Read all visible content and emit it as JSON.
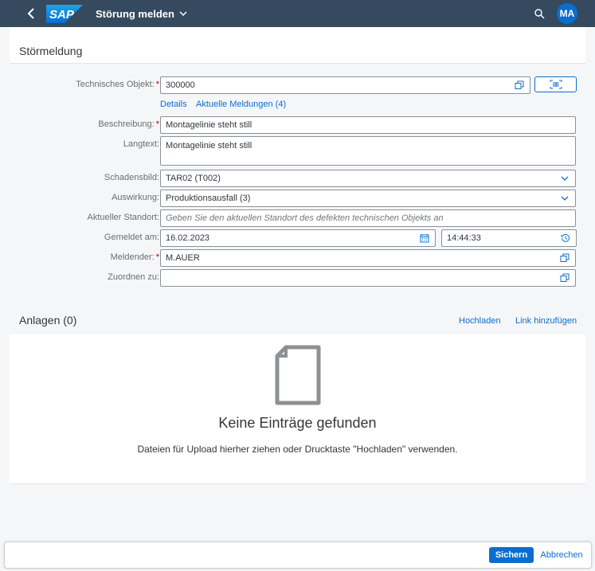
{
  "shell": {
    "app_title": "Störung melden",
    "user_initials": "MA",
    "logo_text": "SAP"
  },
  "section": {
    "title": "Störmeldung"
  },
  "form": {
    "technical_object": {
      "label": "Technisches Objekt:",
      "value": "300000"
    },
    "links": {
      "details": "Details",
      "current_reports": "Aktuelle Meldungen (4)"
    },
    "description": {
      "label": "Beschreibung:",
      "value": "Montagelinie steht still"
    },
    "long_text": {
      "label": "Langtext:",
      "value": "Montagelinie steht still"
    },
    "damage": {
      "label": "Schadensbild:",
      "value": "TAR02 (T002)"
    },
    "effect": {
      "label": "Auswirkung:",
      "value": "Produktionsausfall (3)"
    },
    "location": {
      "label": "Aktueller Standort:",
      "placeholder": "Geben Sie den aktuellen Standort des defekten technischen Objekts an"
    },
    "reported_on": {
      "label": "Gemeldet am:",
      "date": "16.02.2023",
      "time": "14:44:33"
    },
    "reporter": {
      "label": "Meldender:",
      "value": "M.AUER"
    },
    "assign_to": {
      "label": "Zuordnen zu:",
      "value": ""
    }
  },
  "attachments": {
    "title": "Anlagen (0)",
    "upload_label": "Hochladen",
    "add_link_label": "Link hinzufügen",
    "empty_title": "Keine Einträge gefunden",
    "empty_description": "Dateien für Upload hierher ziehen oder Drucktaste \"Hochladen\" verwenden."
  },
  "footer": {
    "save_label": "Sichern",
    "cancel_label": "Abbrechen"
  },
  "colors": {
    "shell": "#354a5f",
    "accent": "#0a6ed1",
    "required": "#bb0000"
  },
  "icons": {
    "back": "chevron-left-icon",
    "title_dropdown": "chevron-down-icon",
    "search": "search-icon",
    "value_help": "value-help-icon",
    "barcode": "barcode-scanner-icon",
    "dropdown": "chevron-down-icon",
    "calendar": "calendar-icon",
    "time": "clock-icon",
    "document": "document-icon"
  }
}
